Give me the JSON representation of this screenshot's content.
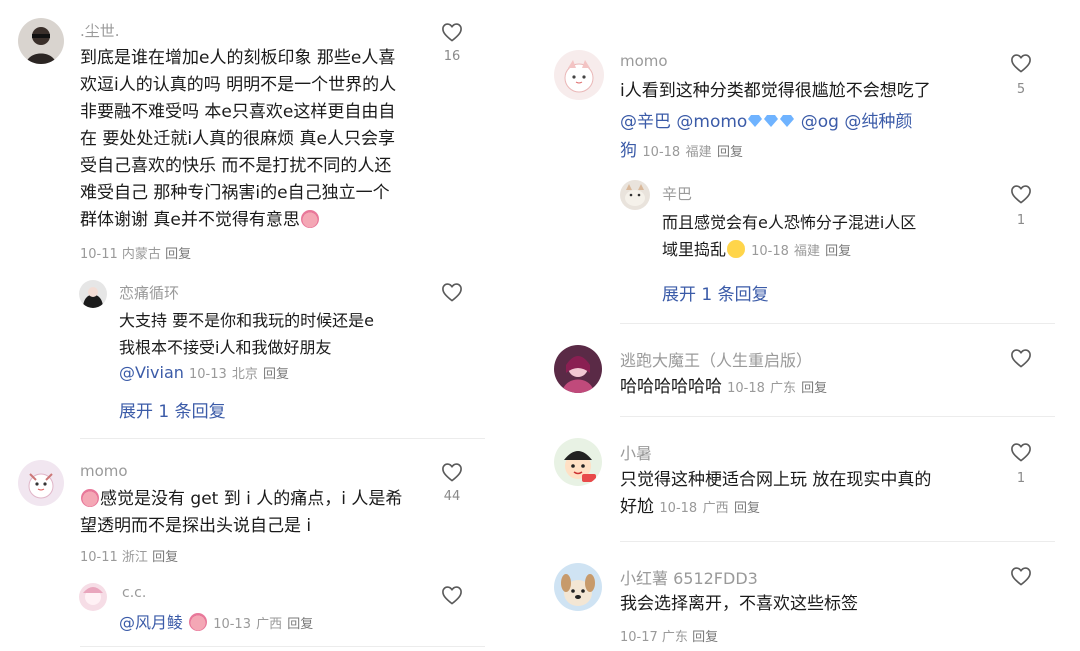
{
  "left_column": {
    "comment1": {
      "username": ".尘世.",
      "lines": [
        "到底是谁在增加e人的刻板印象 那些e人喜",
        "欢逗i人的认真的吗 明明不是一个世界的人",
        "非要融不难受吗 本e只喜欢e这样更自由自",
        "在 要处处迁就i人真的很麻烦 真e人只会享",
        "受自己喜欢的快乐 而不是打扰不同的人还",
        "难受自己 那种专门祸害i的e自己独立一个",
        "群体谢谢 真e并不觉得有意思"
      ],
      "date": "10-11",
      "location": "内蒙古",
      "reply_label": "回复",
      "likes": "16",
      "reply": {
        "username": "恋痛循环",
        "lines": [
          "大支持 要不是你和我玩的时候还是e",
          "我根本不接受i人和我做好朋友"
        ],
        "mention": "@Vivian",
        "date": "10-13",
        "location": "北京",
        "reply_label": "回复"
      },
      "expand_label": "展开 1 条回复"
    },
    "comment2": {
      "username": "momo",
      "lines": [
        "感觉是没有 get 到 i 人的痛点，i 人是希",
        "望透明而不是探出头说自己是 i"
      ],
      "date": "10-11",
      "location": "浙江",
      "reply_label": "回复",
      "likes": "44",
      "reply": {
        "username": "c.c.",
        "mention": "@风月鲮",
        "date": "10-13",
        "location": "广西",
        "reply_label": "回复"
      }
    }
  },
  "right_column": {
    "comment1": {
      "username": "momo",
      "lines": [
        "i人看到这种分类都觉得很尴尬不会想吃了"
      ],
      "mentions_line": [
        "@辛巴",
        "@momo",
        "@og",
        "@纯种颜"
      ],
      "mention_tail": "狗",
      "date": "10-18",
      "location": "福建",
      "reply_label": "回复",
      "likes": "5",
      "reply": {
        "username": "辛巴",
        "lines": [
          "而且感觉会有e人恐怖分子混进i人区",
          "域里捣乱"
        ],
        "date": "10-18",
        "location": "福建",
        "reply_label": "回复",
        "likes": "1"
      },
      "expand_label": "展开 1 条回复"
    },
    "comment2": {
      "username": "逃跑大魔王（人生重启版）",
      "text": "哈哈哈哈哈哈",
      "date": "10-18",
      "location": "广东",
      "reply_label": "回复"
    },
    "comment3": {
      "username": "小暑",
      "lines": [
        "只觉得这种梗适合网上玩  放在现实中真的",
        "好尬"
      ],
      "date": "10-18",
      "location": "广西",
      "reply_label": "回复",
      "likes": "1"
    },
    "comment4": {
      "username": "小红薯 6512FDD3",
      "text": "我会选择离开，不喜欢这些标签",
      "date": "10-17",
      "location": "广东",
      "reply_label": "回复"
    }
  },
  "colors": {
    "mention": "#3b5ba8",
    "muted": "#9a9a9a",
    "divider": "#ececec"
  }
}
